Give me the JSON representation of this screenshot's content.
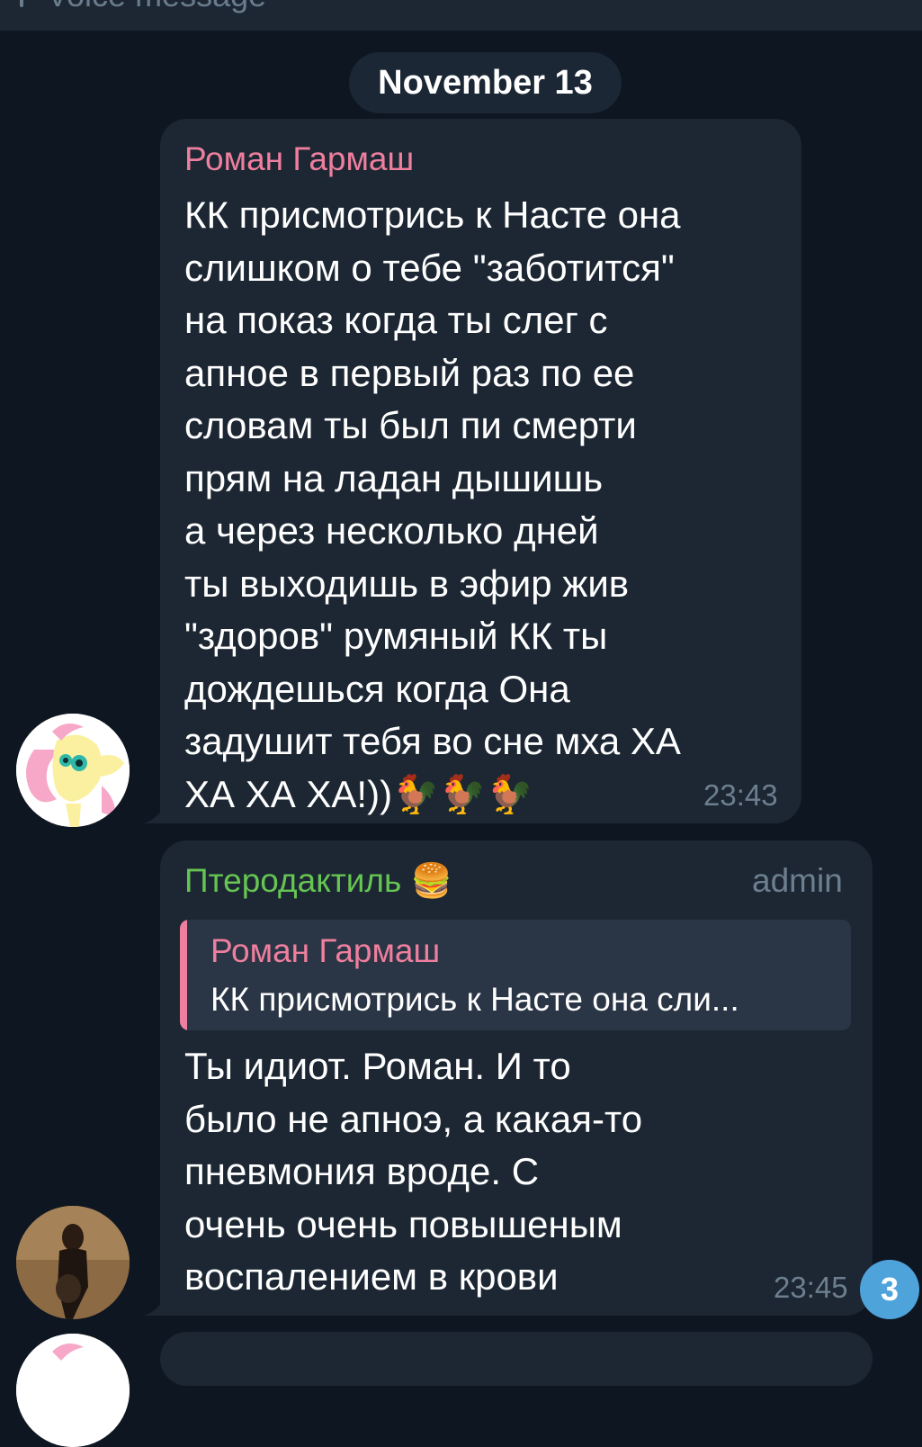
{
  "top": {
    "partial_text": "Voice message"
  },
  "date_label": "November 13",
  "messages": [
    {
      "sender": "Роман Гармаш",
      "sender_color": "#ee7f9e",
      "text": "КК присмотрись к Насте она\nслишком о тебе \"заботится\"\nна показ когда ты слег с\nапное в первый раз по ее\nсловам ты был пи смерти\nпрям на ладан дышишь\nа через несколько дней\nты выходишь в эфир жив\n\"здоров\" румяный КК ты\nдождешься когда Она\nзадушит тебя во сне мха ХА\nХА ХА ХА!))🐓🐓🐓",
      "time": "23:43",
      "avatar_icon": "pony-avatar"
    },
    {
      "sender": "Птеродактиль 🍔",
      "sender_color": "#66c552",
      "role": "admin",
      "reply": {
        "name": "Роман Гармаш",
        "text": "КК присмотрись к Насте она сли..."
      },
      "text": "Ты идиот. Роман. И то\nбыло не апноэ, а какая-то\nпневмония вроде. С\nочень очень повышеным\nвоспалением в крови",
      "time": "23:45",
      "avatar_icon": "photo-avatar"
    }
  ],
  "unread_badge": "3",
  "colors": {
    "background": "#0e1621",
    "bubble": "#1c2733",
    "accent": "#4fa3db"
  }
}
